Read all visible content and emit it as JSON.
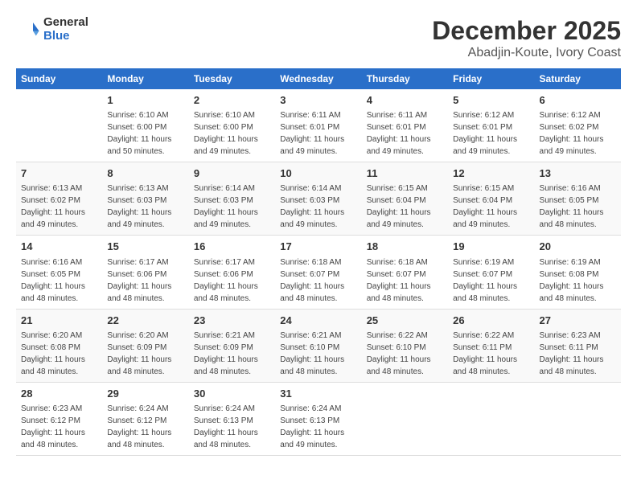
{
  "header": {
    "logo_general": "General",
    "logo_blue": "Blue",
    "title": "December 2025",
    "subtitle": "Abadjin-Koute, Ivory Coast"
  },
  "calendar": {
    "days_of_week": [
      "Sunday",
      "Monday",
      "Tuesday",
      "Wednesday",
      "Thursday",
      "Friday",
      "Saturday"
    ],
    "weeks": [
      [
        {
          "day": "",
          "info": ""
        },
        {
          "day": "1",
          "info": "Sunrise: 6:10 AM\nSunset: 6:00 PM\nDaylight: 11 hours\nand 50 minutes."
        },
        {
          "day": "2",
          "info": "Sunrise: 6:10 AM\nSunset: 6:00 PM\nDaylight: 11 hours\nand 49 minutes."
        },
        {
          "day": "3",
          "info": "Sunrise: 6:11 AM\nSunset: 6:01 PM\nDaylight: 11 hours\nand 49 minutes."
        },
        {
          "day": "4",
          "info": "Sunrise: 6:11 AM\nSunset: 6:01 PM\nDaylight: 11 hours\nand 49 minutes."
        },
        {
          "day": "5",
          "info": "Sunrise: 6:12 AM\nSunset: 6:01 PM\nDaylight: 11 hours\nand 49 minutes."
        },
        {
          "day": "6",
          "info": "Sunrise: 6:12 AM\nSunset: 6:02 PM\nDaylight: 11 hours\nand 49 minutes."
        }
      ],
      [
        {
          "day": "7",
          "info": "Sunrise: 6:13 AM\nSunset: 6:02 PM\nDaylight: 11 hours\nand 49 minutes."
        },
        {
          "day": "8",
          "info": "Sunrise: 6:13 AM\nSunset: 6:03 PM\nDaylight: 11 hours\nand 49 minutes."
        },
        {
          "day": "9",
          "info": "Sunrise: 6:14 AM\nSunset: 6:03 PM\nDaylight: 11 hours\nand 49 minutes."
        },
        {
          "day": "10",
          "info": "Sunrise: 6:14 AM\nSunset: 6:03 PM\nDaylight: 11 hours\nand 49 minutes."
        },
        {
          "day": "11",
          "info": "Sunrise: 6:15 AM\nSunset: 6:04 PM\nDaylight: 11 hours\nand 49 minutes."
        },
        {
          "day": "12",
          "info": "Sunrise: 6:15 AM\nSunset: 6:04 PM\nDaylight: 11 hours\nand 49 minutes."
        },
        {
          "day": "13",
          "info": "Sunrise: 6:16 AM\nSunset: 6:05 PM\nDaylight: 11 hours\nand 48 minutes."
        }
      ],
      [
        {
          "day": "14",
          "info": "Sunrise: 6:16 AM\nSunset: 6:05 PM\nDaylight: 11 hours\nand 48 minutes."
        },
        {
          "day": "15",
          "info": "Sunrise: 6:17 AM\nSunset: 6:06 PM\nDaylight: 11 hours\nand 48 minutes."
        },
        {
          "day": "16",
          "info": "Sunrise: 6:17 AM\nSunset: 6:06 PM\nDaylight: 11 hours\nand 48 minutes."
        },
        {
          "day": "17",
          "info": "Sunrise: 6:18 AM\nSunset: 6:07 PM\nDaylight: 11 hours\nand 48 minutes."
        },
        {
          "day": "18",
          "info": "Sunrise: 6:18 AM\nSunset: 6:07 PM\nDaylight: 11 hours\nand 48 minutes."
        },
        {
          "day": "19",
          "info": "Sunrise: 6:19 AM\nSunset: 6:07 PM\nDaylight: 11 hours\nand 48 minutes."
        },
        {
          "day": "20",
          "info": "Sunrise: 6:19 AM\nSunset: 6:08 PM\nDaylight: 11 hours\nand 48 minutes."
        }
      ],
      [
        {
          "day": "21",
          "info": "Sunrise: 6:20 AM\nSunset: 6:08 PM\nDaylight: 11 hours\nand 48 minutes."
        },
        {
          "day": "22",
          "info": "Sunrise: 6:20 AM\nSunset: 6:09 PM\nDaylight: 11 hours\nand 48 minutes."
        },
        {
          "day": "23",
          "info": "Sunrise: 6:21 AM\nSunset: 6:09 PM\nDaylight: 11 hours\nand 48 minutes."
        },
        {
          "day": "24",
          "info": "Sunrise: 6:21 AM\nSunset: 6:10 PM\nDaylight: 11 hours\nand 48 minutes."
        },
        {
          "day": "25",
          "info": "Sunrise: 6:22 AM\nSunset: 6:10 PM\nDaylight: 11 hours\nand 48 minutes."
        },
        {
          "day": "26",
          "info": "Sunrise: 6:22 AM\nSunset: 6:11 PM\nDaylight: 11 hours\nand 48 minutes."
        },
        {
          "day": "27",
          "info": "Sunrise: 6:23 AM\nSunset: 6:11 PM\nDaylight: 11 hours\nand 48 minutes."
        }
      ],
      [
        {
          "day": "28",
          "info": "Sunrise: 6:23 AM\nSunset: 6:12 PM\nDaylight: 11 hours\nand 48 minutes."
        },
        {
          "day": "29",
          "info": "Sunrise: 6:24 AM\nSunset: 6:12 PM\nDaylight: 11 hours\nand 48 minutes."
        },
        {
          "day": "30",
          "info": "Sunrise: 6:24 AM\nSunset: 6:13 PM\nDaylight: 11 hours\nand 48 minutes."
        },
        {
          "day": "31",
          "info": "Sunrise: 6:24 AM\nSunset: 6:13 PM\nDaylight: 11 hours\nand 49 minutes."
        },
        {
          "day": "",
          "info": ""
        },
        {
          "day": "",
          "info": ""
        },
        {
          "day": "",
          "info": ""
        }
      ]
    ]
  }
}
